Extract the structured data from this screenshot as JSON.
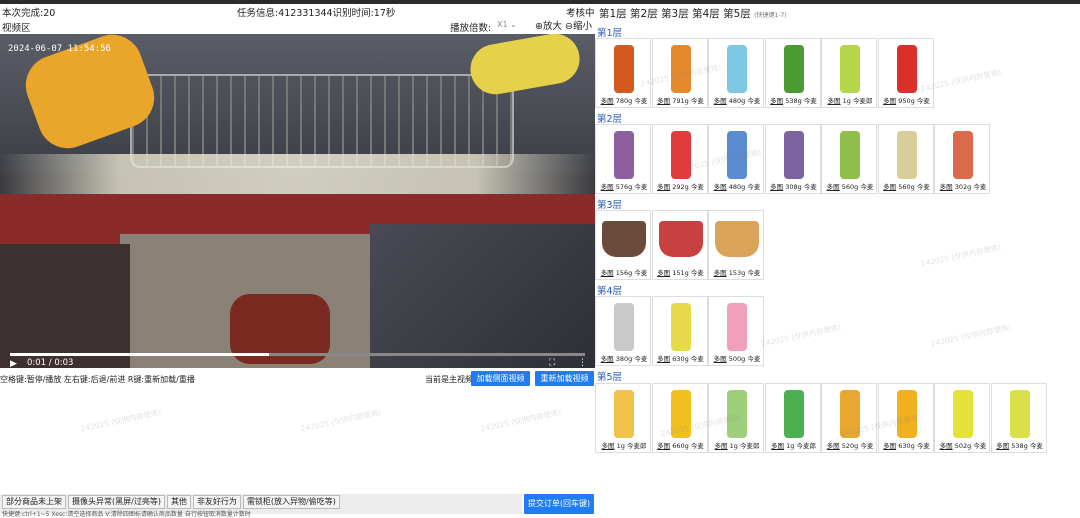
{
  "header": {
    "done": "本次完成:20",
    "task_info": "任务信息:412331344识别时间:17秒",
    "status": "考核中",
    "video_area": "视频区",
    "speed_label": "播放倍数:",
    "speed_value": "X1",
    "zoom_in": "放大",
    "zoom_out": "缩小"
  },
  "layer_tabs": [
    "第1层",
    "第2层",
    "第3层",
    "第4层",
    "第5层"
  ],
  "layer_tab_note": "(快捷键1-7)",
  "video": {
    "timestamp": "2024-06-07 11:54:56",
    "time": "0:01 / 0:03",
    "progress": 0.45,
    "hint": "空格键:暂停/播放 左右键:后退/前进 R键:重新加载/重播",
    "current": "当前是主视频",
    "load_side": "加载侧面视频",
    "reload": "重新加载视频"
  },
  "bottom_tabs": [
    "部分商品未上架",
    "摄像头异常(黑屏/过亮等)",
    "其他",
    "非友好行为",
    "需锁柜(放入异物/偷吃等)"
  ],
  "bottom_hint": "快捷键:ctrl+1~5 Xesc:清空选择商品 V:清除四图标请确认商品数量 自行按钮取消数量计数时",
  "submit": "提交订单(回车键)",
  "watermark": "242025 (仅供内部使用)",
  "layers": [
    {
      "title": "第1层",
      "items": [
        {
          "label": "多图",
          "weight": "780g 今麦",
          "color": "#d35a1e"
        },
        {
          "label": "多图",
          "weight": "791g 今麦",
          "color": "#e58a2c"
        },
        {
          "label": "多图",
          "weight": "480g 今麦",
          "color": "#7fc7e6"
        },
        {
          "label": "多图",
          "weight": "538g 今麦",
          "color": "#4c9a32"
        },
        {
          "label": "多图",
          "weight": "1g 今麦郎",
          "color": "#b5d64a"
        },
        {
          "label": "多图",
          "weight": "950g 今麦",
          "color": "#d9302a"
        }
      ]
    },
    {
      "title": "第2层",
      "items": [
        {
          "label": "多图",
          "weight": "576g 今麦",
          "color": "#8b5fa0"
        },
        {
          "label": "多图",
          "weight": "292g 今麦",
          "color": "#e23b3b"
        },
        {
          "label": "多图",
          "weight": "480g 今麦",
          "color": "#5b8bd0"
        },
        {
          "label": "多图",
          "weight": "308g 今麦",
          "color": "#7e63a3"
        },
        {
          "label": "多图",
          "weight": "560g 今麦",
          "color": "#8fbf4a"
        },
        {
          "label": "多图",
          "weight": "560g 今麦",
          "color": "#d9cf9a"
        },
        {
          "label": "多图",
          "weight": "302g 今麦",
          "color": "#d96a4a"
        }
      ]
    },
    {
      "title": "第3层",
      "items": [
        {
          "label": "多图",
          "weight": "156g 今麦",
          "color": "#6a4a3a",
          "cup": true
        },
        {
          "label": "多图",
          "weight": "151g 今麦",
          "color": "#c94040",
          "cup": true
        },
        {
          "label": "多图",
          "weight": "153g 今麦",
          "color": "#d9a45a",
          "cup": true
        }
      ]
    },
    {
      "title": "第4层",
      "items": [
        {
          "label": "多图",
          "weight": "380g 今麦",
          "color": "#c9c9c9"
        },
        {
          "label": "多图",
          "weight": "630g 今麦",
          "color": "#e6d94a"
        },
        {
          "label": "多图",
          "weight": "500g 今麦",
          "color": "#f0a0b8"
        }
      ]
    },
    {
      "title": "第5层",
      "items": [
        {
          "label": "多图",
          "weight": "1g 今麦郎",
          "color": "#f2c14a"
        },
        {
          "label": "多图",
          "weight": "660g 今麦",
          "color": "#f0c020"
        },
        {
          "label": "多图",
          "weight": "1g 今麦郎",
          "color": "#9fcf7a"
        },
        {
          "label": "多图",
          "weight": "1g 今麦郎",
          "color": "#4caf50"
        },
        {
          "label": "多图",
          "weight": "520g 今麦",
          "color": "#e8a830"
        },
        {
          "label": "多图",
          "weight": "630g 今麦",
          "color": "#f0b020"
        },
        {
          "label": "多图",
          "weight": "502g 今麦",
          "color": "#e6e03a"
        },
        {
          "label": "多图",
          "weight": "538g 今麦",
          "color": "#d9e04a"
        }
      ]
    }
  ]
}
